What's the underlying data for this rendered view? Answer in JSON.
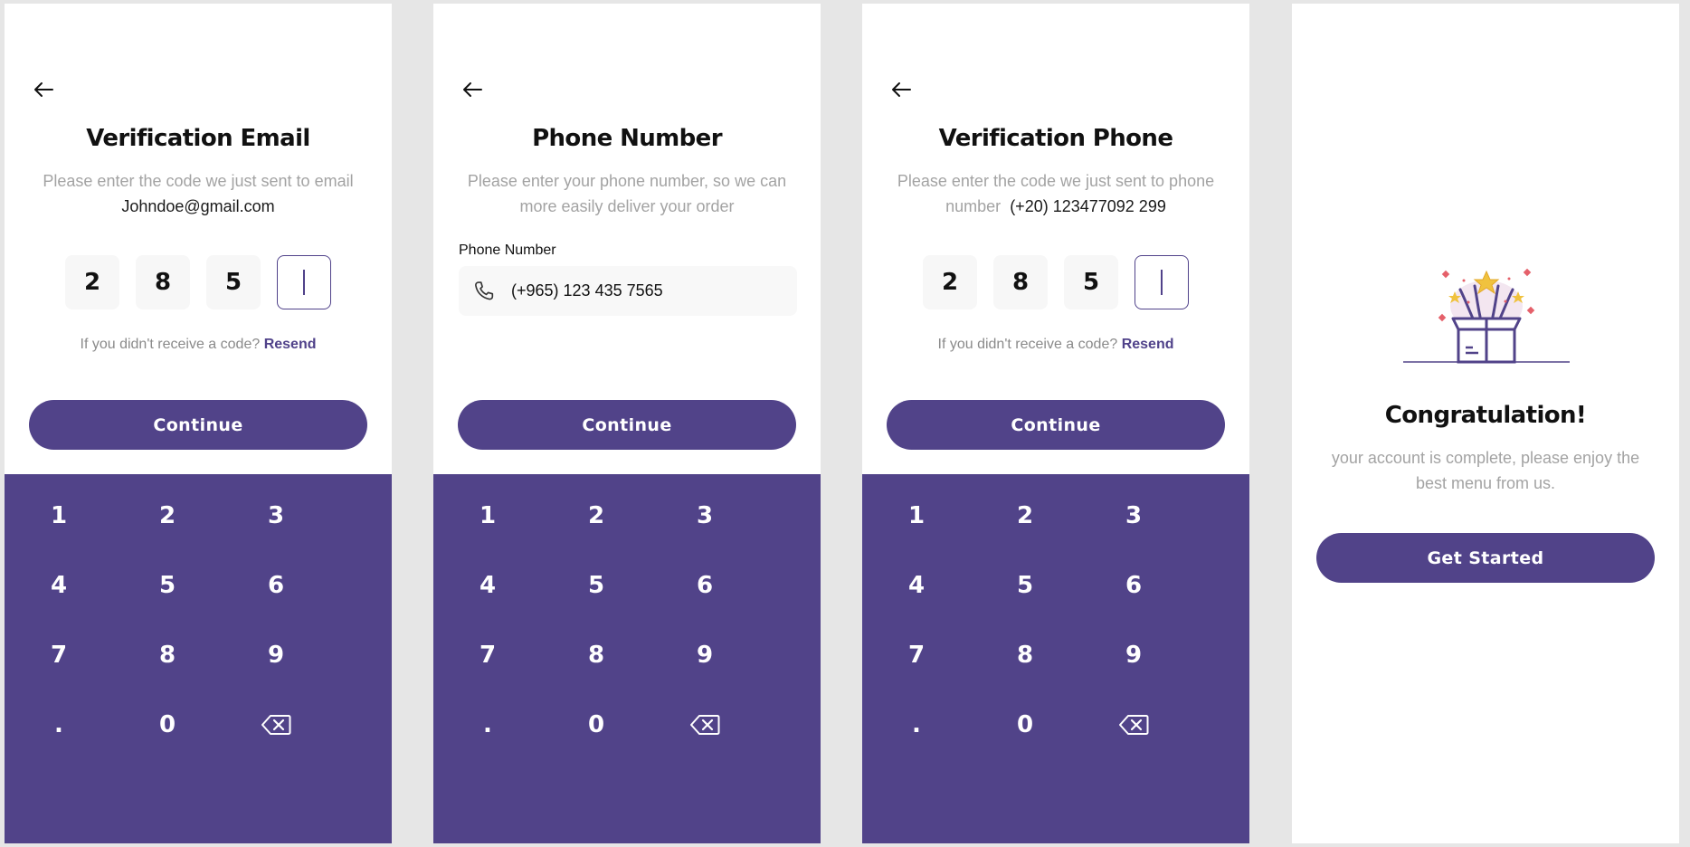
{
  "colors": {
    "primary": "#514389",
    "muted_text": "#a3a3a3",
    "input_bg": "#f8f8f8"
  },
  "icons": [
    "back-arrow-icon",
    "phone-icon",
    "backspace-icon",
    "gift-box-celebration-icon"
  ],
  "screen1": {
    "title": "Verification Email",
    "subtitle": "Please enter the code we just sent to email",
    "email": "Johndoe@gmail.com",
    "code": [
      "2",
      "8",
      "5",
      ""
    ],
    "resend_prompt": "If you didn't receive a code?",
    "resend_link": "Resend",
    "continue_label": "Continue"
  },
  "screen2": {
    "title": "Phone Number",
    "subtitle": "Please enter your phone number, so we can more easily deliver your order",
    "field_label": "Phone Number",
    "phone_value": "(+965) 123 435 7565",
    "continue_label": "Continue"
  },
  "screen3": {
    "title": "Verification Phone",
    "subtitle": "Please enter the code we just sent to phone number",
    "phone": "(+20) 123477092 299",
    "code": [
      "2",
      "8",
      "5",
      ""
    ],
    "resend_prompt": "If you didn't receive a code?",
    "resend_link": "Resend",
    "continue_label": "Continue"
  },
  "screen4": {
    "title": "Congratulation!",
    "subtitle": "your account is complete, please enjoy the best menu from us.",
    "button_label": "Get Started"
  },
  "keypad": [
    "1",
    "2",
    "3",
    "4",
    "5",
    "6",
    "7",
    "8",
    "9",
    ".",
    "0"
  ]
}
